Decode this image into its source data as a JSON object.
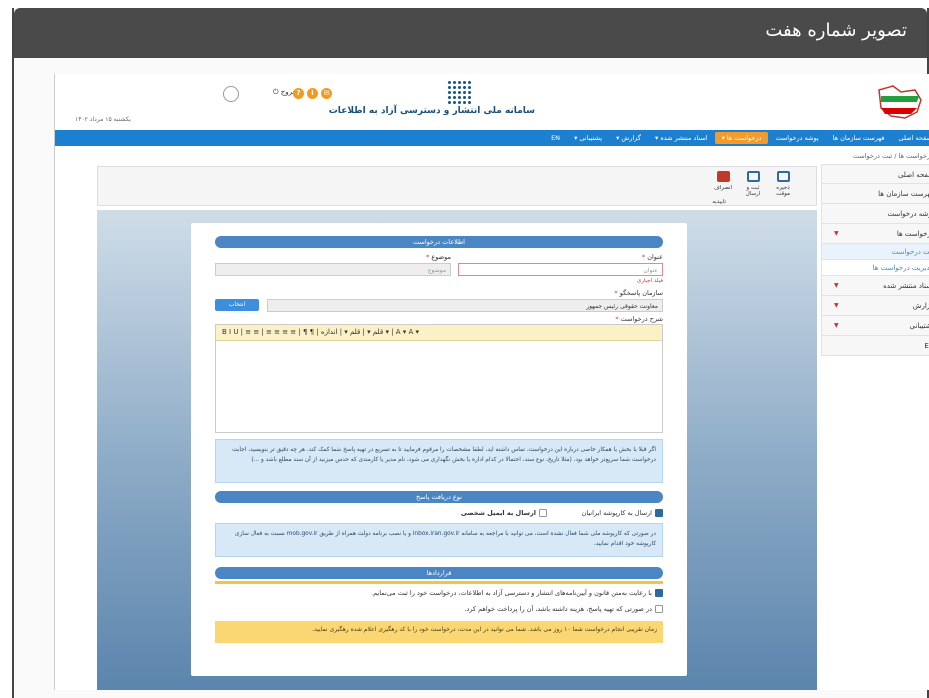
{
  "frame": {
    "title": "تصویر شماره هفت"
  },
  "header": {
    "logo_text": "سامانه ملی انتشار و دسترسی آزاد به اطلاعات",
    "date": "یکشنبه ۱۵ مرداد ۱۴۰۲",
    "logout_label": "خروج",
    "icons": [
      "help-icon",
      "info-icon",
      "mail-icon"
    ]
  },
  "nav": {
    "items": [
      {
        "label": "صفحه اصلی"
      },
      {
        "label": "فهرست سازمان ها"
      },
      {
        "label": "پوشه درخواست"
      },
      {
        "label": "درخواست ها ▾"
      },
      {
        "label": "اسناد منتشر شده ▾"
      },
      {
        "label": "گزارش ▾"
      },
      {
        "label": "پشتیبانی ▾"
      },
      {
        "label": "EN"
      }
    ]
  },
  "breadcrumb": "درخواست ها / ثبت درخواست",
  "sidebar": {
    "items": [
      {
        "label": "صفحه اصلی"
      },
      {
        "label": "فهرست سازمان ها"
      },
      {
        "label": "پوشه درخواست"
      },
      {
        "label": "درخواست ها"
      },
      {
        "label": "ثبت درخواست"
      },
      {
        "label": "مدیریت درخواست ها"
      },
      {
        "label": "اسناد منتشر شده"
      },
      {
        "label": "گزارش"
      },
      {
        "label": "پشتیبانی"
      },
      {
        "label": "EN"
      }
    ]
  },
  "toolbar": {
    "save_draft": "ذخیره موقت",
    "submit": "ثبت و ارسال",
    "cancel": "انصراف",
    "caption": "تاییدیه"
  },
  "form": {
    "section_request": "اطلاعات درخواست",
    "title_label": "عنوان",
    "title_placeholder": "عنوان",
    "title_hint": "فیلد اجباری",
    "subject_label": "موضوع",
    "subject_placeholder": "موضوع",
    "org_label": "سازمان پاسخگو",
    "org_value": "معاونت حقوقی رئیس جمهور",
    "pick_button": "انتخاب",
    "desc_label": "شرح درخواست",
    "editor_toolbar": "B  I  U  |  ≡  ≡  |  ≡  ≡  ≡  ≡  |  ¶  ¶  |  قلم ▾  |  قلم ▾  |  اندازه ▾  |  A ▾  A ▾",
    "info_text": "اگر قبلا با بخش یا همکار خاصی درباره این درخواست، تماس داشته اید، لطفا مشخصات را مرقوم فرمایید تا به تسریع در تهیه پاسخ شما کمک کند. هر چه دقیق تر بنویسید، اجابت درخواست شما سریع‌تر خواهد بود. (مثلا تاریخ، نوع سند، احتمالا در کدام اداره یا بخش نگهداری می شود، نام مدیر یا کارمندی که حدس میزنید از آن سند مطلع باشد و ...)",
    "section_delivery": "نوع دریافت پاسخ",
    "delivery_option1": "ارسال به کارپوشه ایرانیان",
    "delivery_option2": "ارسال به ایمیل شخصی",
    "delivery_info": "در صورتی که کارپوشه ملی شما فعال نشده است، می توانید با مراجعه به سامانه inbox.iran.gov.ir و یا نصب برنامه دولت همراه از طریق mob.gov.ir نسبت به فعال سازی کارپوشه خود اقدام نمایید.",
    "section_contracts": "قراردادها",
    "agree1": "با رعایت به‌متن قانون و آیین‌نامه‌های انتشار و دسترسی آزاد به اطلاعات، درخواست خود را ثبت می‌نمایم.",
    "agree2": "در صورتی که تهیه پاسخ، هزینه داشته باشد، آن را پرداخت خواهم کرد.",
    "warning": "زمان تقریبی انجام درخواست شما ۱۰ روز می باشد. شما می توانید در این مدت، درخواست خود را با کد رهگیری اعلام شده رهگیری نمایید."
  },
  "colors": {
    "nav": "#1d7fd0",
    "accent": "#f39c2d",
    "frame": "#4a4a4a"
  }
}
